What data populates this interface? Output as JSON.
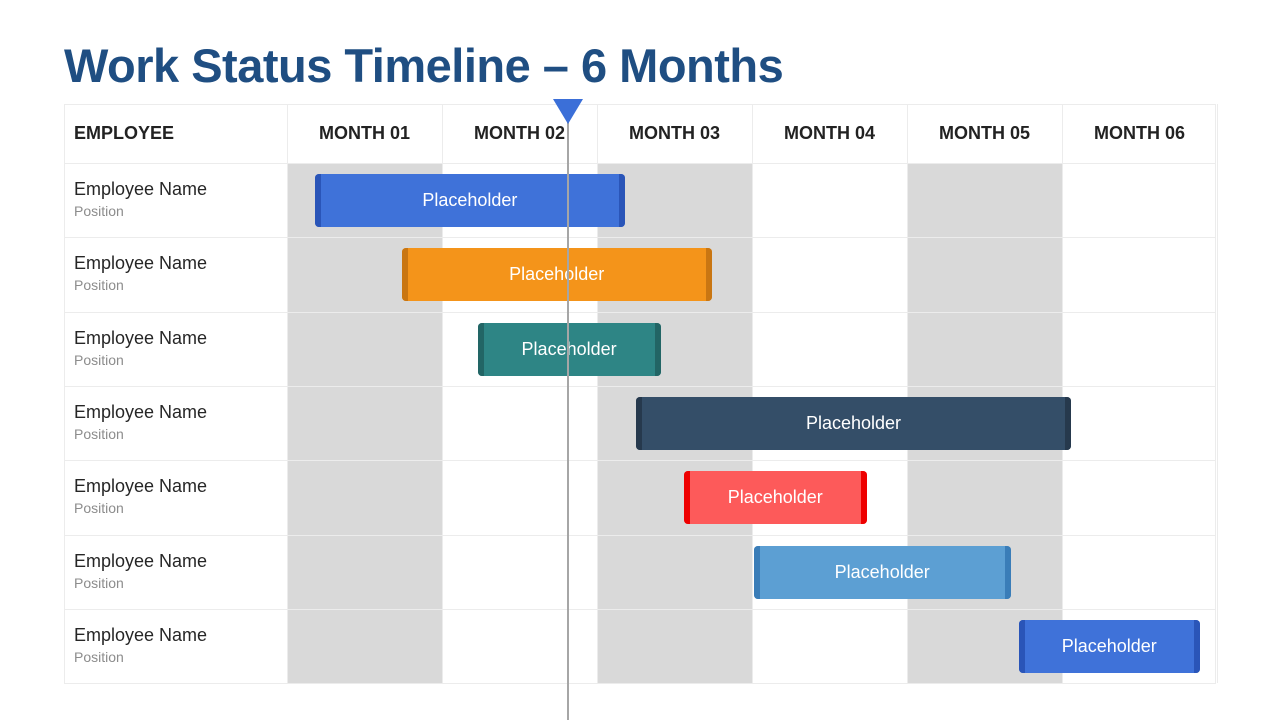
{
  "title": "Work Status Timeline – 6 Months",
  "header": {
    "employee_label": "EMPLOYEE",
    "months": [
      "MONTH 01",
      "MONTH 02",
      "MONTH 03",
      "MONTH 04",
      "MONTH 05",
      "MONTH 06"
    ],
    "shaded_months": [
      0,
      2,
      4
    ]
  },
  "current_marker": {
    "month_position": 1.81,
    "color": "#3b6fd8"
  },
  "chart_data": {
    "type": "gantt",
    "title": "Work Status Timeline – 6 Months",
    "xlabel": "",
    "ylabel": "EMPLOYEE",
    "x_categories": [
      "MONTH 01",
      "MONTH 02",
      "MONTH 03",
      "MONTH 04",
      "MONTH 05",
      "MONTH 06"
    ],
    "x_range_months": [
      0,
      6
    ],
    "current_time_months": 1.81,
    "tasks": [
      {
        "employee": "Employee Name",
        "position": "Position",
        "label": "Placeholder",
        "start": 0.18,
        "end": 2.18,
        "color": "#3f72d9",
        "cap": "#2a55b8"
      },
      {
        "employee": "Employee Name",
        "position": "Position",
        "label": "Placeholder",
        "start": 0.74,
        "end": 2.74,
        "color": "#f4941a",
        "cap": "#c97612"
      },
      {
        "employee": "Employee Name",
        "position": "Position",
        "label": "Placeholder",
        "start": 1.23,
        "end": 2.41,
        "color": "#2e8585",
        "cap": "#226565"
      },
      {
        "employee": "Employee Name",
        "position": "Position",
        "label": "Placeholder",
        "start": 2.25,
        "end": 5.06,
        "color": "#344e68",
        "cap": "#26394d"
      },
      {
        "employee": "Employee Name",
        "position": "Position",
        "label": "Placeholder",
        "start": 2.56,
        "end": 3.74,
        "color": "#fd5a5a",
        "cap": "#ee0000"
      },
      {
        "employee": "Employee Name",
        "position": "Position",
        "label": "Placeholder",
        "start": 3.01,
        "end": 4.67,
        "color": "#5c9fd3",
        "cap": "#3a7db8"
      },
      {
        "employee": "Employee Name",
        "position": "Position",
        "label": "Placeholder",
        "start": 4.72,
        "end": 5.89,
        "color": "#3f72d9",
        "cap": "#2a55b8"
      }
    ]
  }
}
